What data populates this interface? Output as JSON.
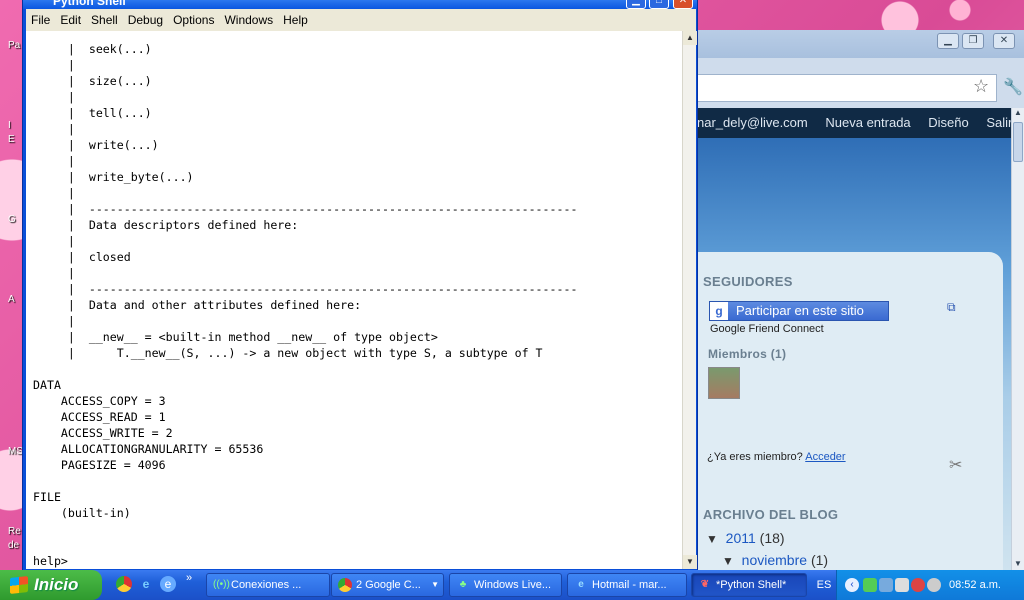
{
  "desktop": {
    "icon_labels": [
      "Pa",
      "I",
      "E",
      "G",
      "A",
      "MS",
      "Re",
      "de"
    ]
  },
  "python_shell": {
    "title": "Python Shell",
    "menu": [
      "File",
      "Edit",
      "Shell",
      "Debug",
      "Options",
      "Windows",
      "Help"
    ],
    "content": "     |  seek(...)\n     |\n     |  size(...)\n     |\n     |  tell(...)\n     |\n     |  write(...)\n     |\n     |  write_byte(...)\n     |\n     |  ----------------------------------------------------------------------\n     |  Data descriptors defined here:\n     |\n     |  closed\n     |\n     |  ----------------------------------------------------------------------\n     |  Data and other attributes defined here:\n     |\n     |  __new__ = <built-in method __new__ of type object>\n     |      T.__new__(S, ...) -> a new object with type S, a subtype of T\n\nDATA\n    ACCESS_COPY = 3\n    ACCESS_READ = 1\n    ACCESS_WRITE = 2\n    ALLOCATIONGRANULARITY = 65536\n    PAGESIZE = 4096\n\nFILE\n    (built-in)\n\n\nhelp> "
  },
  "chrome": {
    "blogger_bar": [
      "nar_dely@live.com",
      "Nueva entrada",
      "Diseño",
      "Salir"
    ],
    "seguidores_title": "SEGUIDORES",
    "gfc_button": "Participar en este sitio",
    "gfc_caption": "Google Friend Connect",
    "members": "Miembros (1)",
    "already_member": "¿Ya eres miembro?",
    "login_link": "Acceder",
    "archive_title": "ARCHIVO DEL BLOG",
    "archive_year": "2011",
    "archive_year_count": "(18)",
    "archive_month": "noviembre",
    "archive_month_count": "(1)"
  },
  "taskbar": {
    "start": "Inicio",
    "tasks": [
      {
        "label": "Conexiones ...",
        "icon": "network-icon"
      },
      {
        "label": "2 Google C...",
        "icon": "chrome-icon"
      },
      {
        "label": "Windows Live...",
        "icon": "messenger-icon"
      },
      {
        "label": "Hotmail - mar...",
        "icon": "ie-icon"
      },
      {
        "label": "*Python Shell*",
        "icon": "python-icon"
      }
    ],
    "lang": "ES",
    "clock": "08:52 a.m."
  }
}
